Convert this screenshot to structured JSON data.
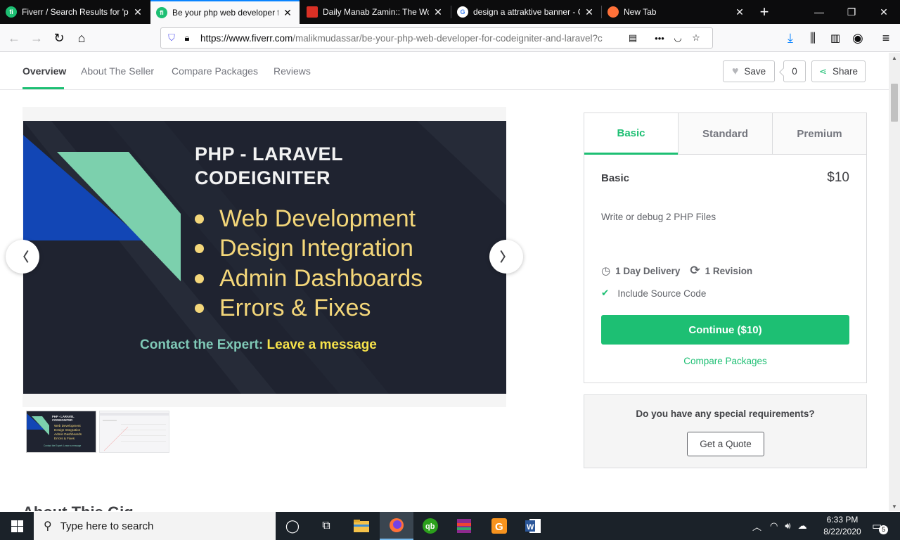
{
  "browser": {
    "tabs": [
      {
        "title": "Fiverr / Search Results for 'php",
        "active": false
      },
      {
        "title": "Be your php web developer for",
        "active": true
      },
      {
        "title": "Daily Manab Zamin:: The World",
        "active": false
      },
      {
        "title": "design a attraktive banner - Google",
        "active": false
      },
      {
        "title": "New Tab",
        "active": false
      }
    ],
    "url_host": "https://www.fiverr.com",
    "url_path": "/malikmudassar/be-your-php-web-developer-for-codeigniter-and-laravel?c"
  },
  "subnav": {
    "items": [
      "Overview",
      "About The Seller",
      "Compare Packages",
      "Reviews"
    ],
    "save_label": "Save",
    "save_count": "0",
    "share_label": "Share"
  },
  "banner": {
    "title_line1": "PHP - LARAVEL",
    "title_line2": "CODEIGNITER",
    "bullets": [
      "Web Development",
      "Design Integration",
      "Admin Dashboards",
      "Errors & Fixes"
    ],
    "contact_prefix": "Contact the Expert: ",
    "contact_action": "Leave a message"
  },
  "thumb_text": {
    "title1": "PHP - LARAVEL",
    "title2": "CODEIGNITER",
    "b1": "Web Development",
    "b2": "Design Integration",
    "b3": "Admin Dashboards",
    "b4": "Errors & Fixes",
    "contact": "Contact the Expert: Leave a message"
  },
  "package": {
    "tabs": [
      "Basic",
      "Standard",
      "Premium"
    ],
    "name": "Basic",
    "price": "$10",
    "description": "Write or debug 2 PHP Files",
    "delivery": "1 Day Delivery",
    "revisions": "1 Revision",
    "include": "Include Source Code",
    "continue_label": "Continue ($10)",
    "compare_label": "Compare Packages"
  },
  "quote": {
    "question": "Do you have any special requirements?",
    "button": "Get a Quote"
  },
  "about_heading": "About This Gig",
  "taskbar": {
    "search_placeholder": "Type here to search",
    "time": "6:33 PM",
    "date": "8/22/2020",
    "notification_count": "5"
  },
  "colors": {
    "fiverr_green": "#1dbf73",
    "banner_bg": "#1f2330",
    "banner_text": "#f4d77a"
  }
}
